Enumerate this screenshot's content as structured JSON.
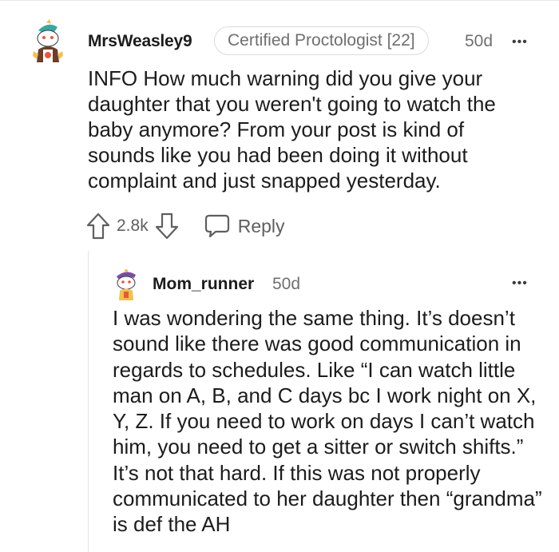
{
  "comment": {
    "username": "MrsWeasley9",
    "flair": "Certified Proctologist [22]",
    "age": "50d",
    "more": "•••",
    "body": "INFO How much warning did you give your daughter that you weren't going to watch the baby anymore? From your post is kind of sounds like you had been doing it without complaint and just snapped yesterday.",
    "score": "2.8k",
    "reply_label": "Reply",
    "icons": {
      "avatar": "snoo-avatar-icon",
      "upvote": "upvote-arrow-icon",
      "downvote": "downvote-arrow-icon",
      "reply": "speech-bubble-icon",
      "more": "more-options-icon"
    }
  },
  "reply": {
    "username": "Mom_runner",
    "age": "50d",
    "more": "•••",
    "body": "I was wondering the same thing. It’s doesn’t sound like there was good communication in regards to schedules. Like “I can watch little man on A, B, and C days bc I work night on X, Y, Z. If you need to work on days I can’t watch him, you need to get a sitter or switch shifts.” It’s not that hard. If this was not properly communicated to her daughter then “grandma” is def the AH",
    "icons": {
      "avatar": "snoo-avatar-icon",
      "more": "more-options-icon"
    }
  },
  "colors": {
    "text": "#1c1c1c",
    "meta": "#6f6f6f",
    "border": "#dcdcdc",
    "thread_line": "#e3e3e3"
  }
}
